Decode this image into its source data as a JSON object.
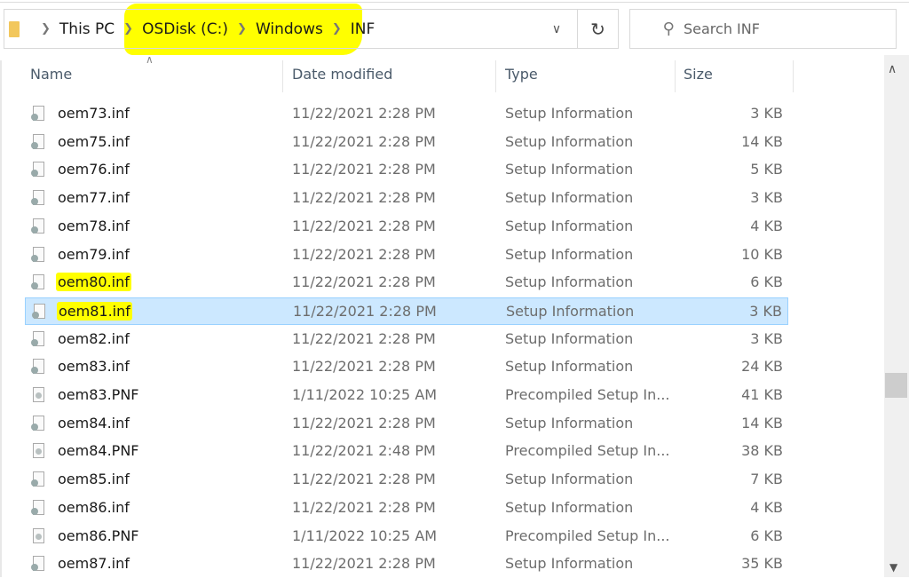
{
  "breadcrumb": {
    "items": [
      "This PC",
      "OSDisk (C:)",
      "Windows",
      "INF"
    ],
    "highlight_color": "#ffff00"
  },
  "search": {
    "placeholder": "Search INF"
  },
  "icons": {
    "folder": "folder-icon",
    "chevron": "chevron-right-icon",
    "dropdown": "chevron-down-icon",
    "refresh": "refresh-icon",
    "search": "search-icon",
    "file": "setup-file-icon"
  },
  "columns": {
    "name": "Name",
    "date": "Date modified",
    "type": "Type",
    "size": "Size"
  },
  "selection_color": "#cce8ff",
  "files": [
    {
      "name": "oem73.inf",
      "date": "11/22/2021 2:28 PM",
      "type": "Setup Information",
      "size": "3 KB"
    },
    {
      "name": "oem75.inf",
      "date": "11/22/2021 2:28 PM",
      "type": "Setup Information",
      "size": "14 KB"
    },
    {
      "name": "oem76.inf",
      "date": "11/22/2021 2:28 PM",
      "type": "Setup Information",
      "size": "5 KB"
    },
    {
      "name": "oem77.inf",
      "date": "11/22/2021 2:28 PM",
      "type": "Setup Information",
      "size": "3 KB"
    },
    {
      "name": "oem78.inf",
      "date": "11/22/2021 2:28 PM",
      "type": "Setup Information",
      "size": "4 KB"
    },
    {
      "name": "oem79.inf",
      "date": "11/22/2021 2:28 PM",
      "type": "Setup Information",
      "size": "10 KB"
    },
    {
      "name": "oem80.inf",
      "date": "11/22/2021 2:28 PM",
      "type": "Setup Information",
      "size": "6 KB",
      "highlighted": true
    },
    {
      "name": "oem81.inf",
      "date": "11/22/2021 2:28 PM",
      "type": "Setup Information",
      "size": "3 KB",
      "highlighted": true,
      "selected": true
    },
    {
      "name": "oem82.inf",
      "date": "11/22/2021 2:28 PM",
      "type": "Setup Information",
      "size": "3 KB"
    },
    {
      "name": "oem83.inf",
      "date": "11/22/2021 2:28 PM",
      "type": "Setup Information",
      "size": "24 KB"
    },
    {
      "name": "oem83.PNF",
      "date": "1/11/2022 10:25 AM",
      "type": "Precompiled Setup In...",
      "size": "41 KB"
    },
    {
      "name": "oem84.inf",
      "date": "11/22/2021 2:28 PM",
      "type": "Setup Information",
      "size": "14 KB"
    },
    {
      "name": "oem84.PNF",
      "date": "11/22/2021 2:48 PM",
      "type": "Precompiled Setup In...",
      "size": "38 KB"
    },
    {
      "name": "oem85.inf",
      "date": "11/22/2021 2:28 PM",
      "type": "Setup Information",
      "size": "7 KB"
    },
    {
      "name": "oem86.inf",
      "date": "11/22/2021 2:28 PM",
      "type": "Setup Information",
      "size": "4 KB"
    },
    {
      "name": "oem86.PNF",
      "date": "1/11/2022 10:25 AM",
      "type": "Precompiled Setup In...",
      "size": "6 KB"
    },
    {
      "name": "oem87.inf",
      "date": "11/22/2021 2:28 PM",
      "type": "Setup Information",
      "size": "35 KB"
    }
  ]
}
